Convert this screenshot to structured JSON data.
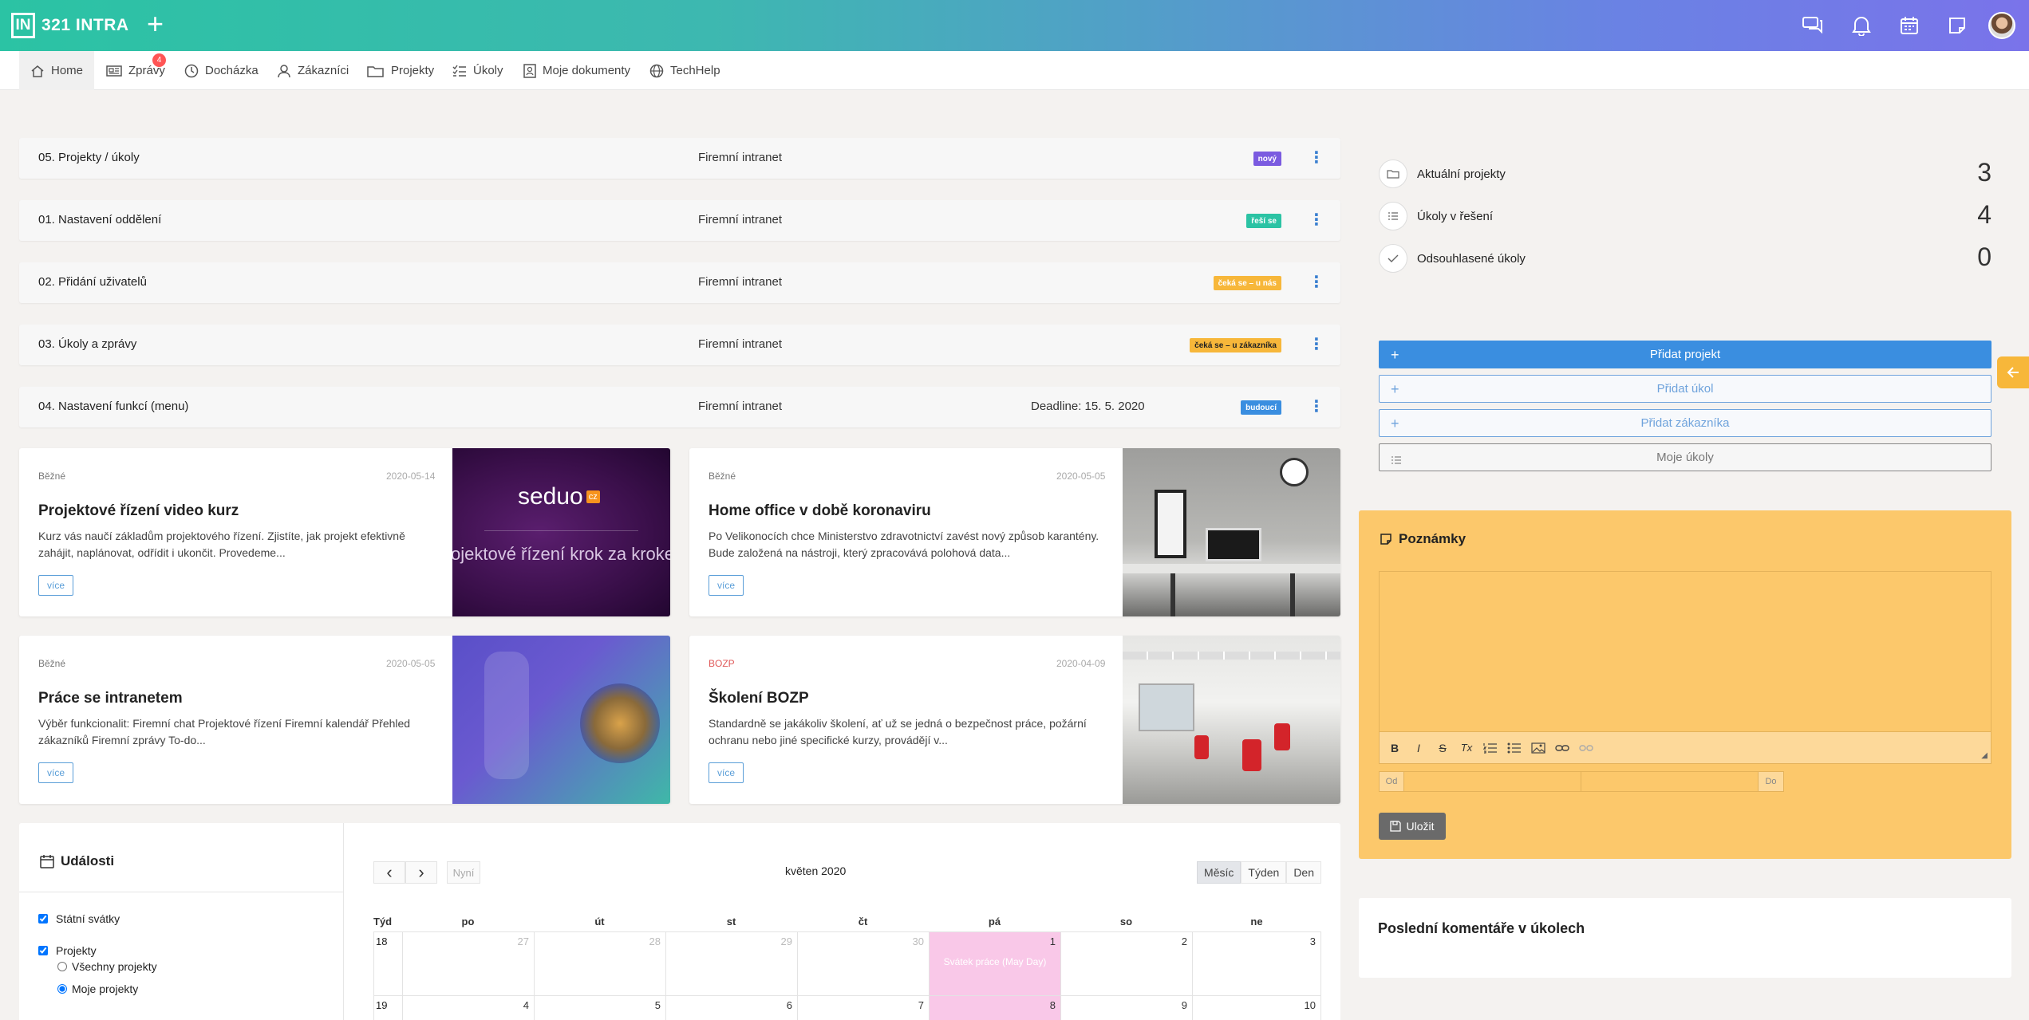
{
  "app": {
    "logo_mark": "IN",
    "logo_text": "321 INTRA",
    "add_symbol": "+"
  },
  "topbar_icons": [
    "chat-icon",
    "bell-icon",
    "calendar-icon",
    "note-icon",
    "user-avatar"
  ],
  "nav": {
    "items": [
      {
        "label": "Home",
        "icon": "home-icon",
        "active": true
      },
      {
        "label": "Zprávy",
        "icon": "news-icon",
        "badge": "4"
      },
      {
        "label": "Docházka",
        "icon": "clock-icon"
      },
      {
        "label": "Zákazníci",
        "icon": "customer-icon"
      },
      {
        "label": "Projekty",
        "icon": "folder-icon"
      },
      {
        "label": "Úkoly",
        "icon": "tasks-icon"
      },
      {
        "label": "Moje dokumenty",
        "icon": "document-icon"
      },
      {
        "label": "TechHelp",
        "icon": "globe-icon"
      }
    ]
  },
  "projects": [
    {
      "name": "05. Projekty / úkoly",
      "client": "Firemní intranet",
      "deadline": "",
      "status": "nový",
      "status_color": "#7b5be0",
      "status_text_color": "#ffffff"
    },
    {
      "name": "01. Nastavení oddělení",
      "client": "Firemní intranet",
      "deadline": "",
      "status": "řeší se",
      "status_color": "#2bc3a4",
      "status_text_color": "#ffffff"
    },
    {
      "name": "02. Přidání uživatelů",
      "client": "Firemní intranet",
      "deadline": "",
      "status": "čeká se – u nás",
      "status_color": "#f7b73a",
      "status_text_color": "#ffffff"
    },
    {
      "name": "03. Úkoly a zprávy",
      "client": "Firemní intranet",
      "deadline": "",
      "status": "čeká se – u zákazníka",
      "status_color": "#f7b73a",
      "status_text_color": "#222222"
    },
    {
      "name": "04. Nastavení funkcí (menu)",
      "client": "Firemní intranet",
      "deadline": "Deadline: 15. 5. 2020",
      "status": "budoucí",
      "status_color": "#3a8ee0",
      "status_text_color": "#ffffff"
    }
  ],
  "menu_symbol": "⋮",
  "articles": [
    {
      "category": "Běžné",
      "category_color": "#777777",
      "date": "2020-05-14",
      "title": "Projektové řízení video kurz",
      "text": "Kurz vás naučí základům projektového řízení. Zjistíte, jak projekt efektivně zahájit, naplánovat, odřídit i ukončit. Provedeme...",
      "more": "více",
      "image_logo": "seduo",
      "image_logo_suffix": "cz",
      "image_caption": "Projektové řízení krok za krokem"
    },
    {
      "category": "Běžné",
      "category_color": "#777777",
      "date": "2020-05-05",
      "title": "Home office v době koronaviru",
      "text": "Po Velikonocích chce Ministerstvo zdravotnictví zavést nový způsob karantény. Bude založená na nástroji, který zpracovává polohová data...",
      "more": "více"
    },
    {
      "category": "Běžné",
      "category_color": "#777777",
      "date": "2020-05-05",
      "title": "Práce se intranetem",
      "text": "Výběr funkcionalit: Firemní chat Projektové řízení Firemní kalendář Přehled zákazníků Firemní zprávy To-do...",
      "more": "více"
    },
    {
      "category": "BOZP",
      "category_color": "#e05a5a",
      "date": "2020-04-09",
      "title": "Školení BOZP",
      "text": "Standardně se jakákoliv školení, ať už se jedná o bezpečnost práce, požární ochranu nebo jiné specifické kurzy, provádějí v...",
      "more": "více"
    }
  ],
  "events": {
    "title": "Události",
    "filters": [
      {
        "label": "Státní svátky",
        "checked": true
      },
      {
        "label": "Projekty",
        "checked": true
      }
    ],
    "radios": [
      {
        "label": "Všechny projekty",
        "checked": false
      },
      {
        "label": "Moje projekty",
        "checked": true
      }
    ]
  },
  "calendar": {
    "prev": "‹",
    "next": "›",
    "today": "Nyní",
    "title": "květen 2020",
    "views": [
      "Měsíc",
      "Týden",
      "Den"
    ],
    "active_view": "Měsíc",
    "week_header": "Týd",
    "weekdays": [
      "po",
      "út",
      "st",
      "čt",
      "pá",
      "so",
      "ne"
    ],
    "weeks": [
      {
        "week": "18",
        "days": [
          "27",
          "28",
          "29",
          "30",
          "1",
          "2",
          "3"
        ],
        "other_month": [
          true,
          true,
          true,
          true,
          false,
          false,
          false
        ]
      },
      {
        "week": "19",
        "days": [
          "4",
          "5",
          "6",
          "7",
          "8",
          "9",
          "10"
        ],
        "other_month": [
          false,
          false,
          false,
          false,
          false,
          false,
          false
        ]
      }
    ],
    "holiday_event": "Svátek práce (May Day)"
  },
  "stats": [
    {
      "label": "Aktuální projekty",
      "value": "3",
      "icon": "folder-icon"
    },
    {
      "label": "Úkoly v řešení",
      "value": "4",
      "icon": "tasks-icon"
    },
    {
      "label": "Odsouhlasené úkoly",
      "value": "0",
      "icon": "check-icon"
    }
  ],
  "actions": [
    {
      "label": "Přidat projekt",
      "primary": true
    },
    {
      "label": "Přidat úkol",
      "primary": false
    },
    {
      "label": "Přidat zákazníka",
      "primary": false
    },
    {
      "label": "Moje úkoly",
      "primary": false,
      "muted": true
    }
  ],
  "notes": {
    "title": "Poznámky",
    "text": "",
    "toolbar": [
      "B",
      "I",
      "S",
      "Tx",
      "ol",
      "ul",
      "image",
      "link",
      "unlink"
    ],
    "from_label": "Od",
    "to_label": "Do",
    "save": "Uložit"
  },
  "comments": {
    "title": "Poslední komentáře v úkolech"
  },
  "colors": {
    "accent": "#3a8ee0",
    "notes_bg": "#fcc86b",
    "holiday": "#f9c8e8"
  }
}
